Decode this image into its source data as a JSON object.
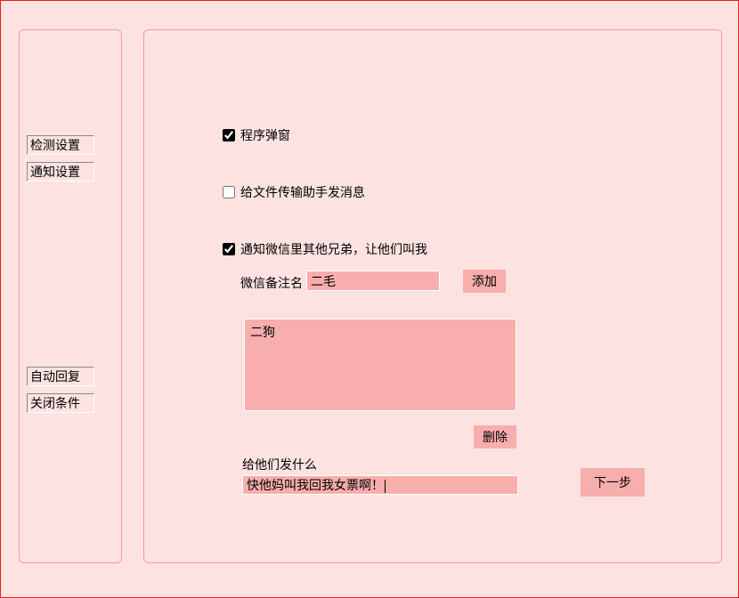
{
  "sidebar": {
    "items": [
      {
        "label": "检测设置"
      },
      {
        "label": "通知设置"
      },
      {
        "label": "自动回复"
      },
      {
        "label": "关闭条件"
      }
    ]
  },
  "main": {
    "option1": {
      "label": "程序弹窗",
      "checked": true
    },
    "option2": {
      "label": "给文件传输助手发消息",
      "checked": false
    },
    "option3": {
      "label": "通知微信里其他兄弟，让他们叫我",
      "checked": true
    },
    "remark": {
      "label": "微信备注名",
      "value": "二毛",
      "add_btn": "添加"
    },
    "list": {
      "items": [
        "二狗"
      ],
      "delete_btn": "删除"
    },
    "message": {
      "label": "给他们发什么",
      "value": "快他妈叫我回我女票啊！"
    },
    "next_btn": "下一步"
  }
}
